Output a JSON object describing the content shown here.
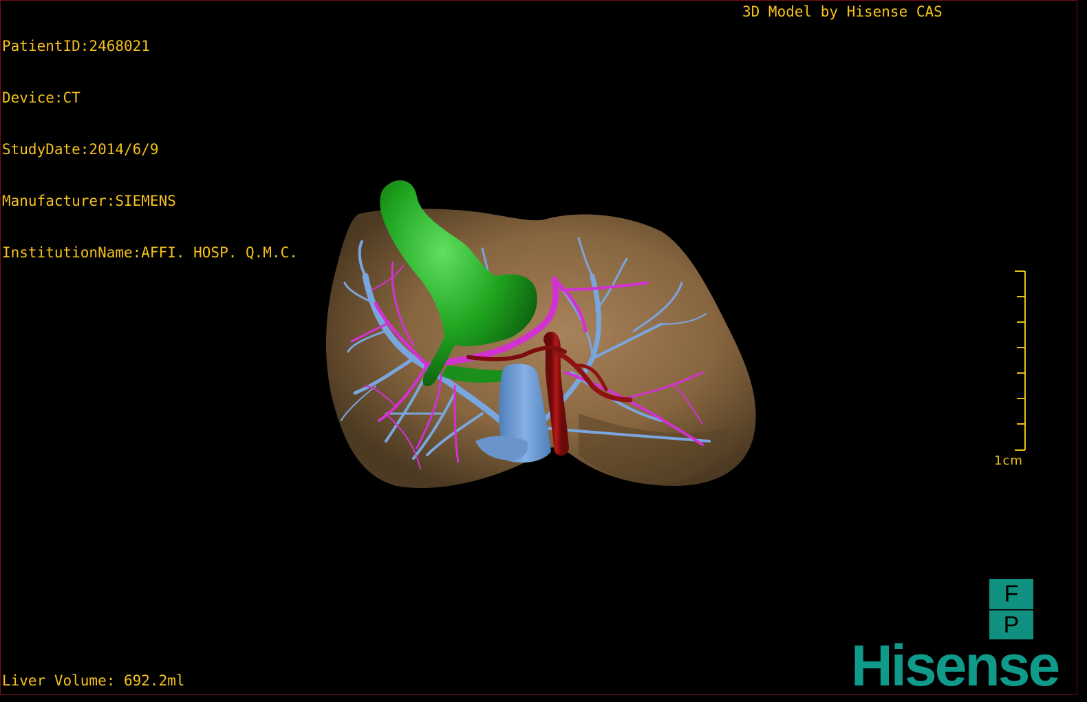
{
  "overlay": {
    "patient_id": "PatientID:2468021",
    "device": "Device:CT",
    "study_date": "StudyDate:2014/6/9",
    "manufacturer": "Manufacturer:SIEMENS",
    "institution": "InstitutionName:AFFI. HOSP. Q.M.C.",
    "credit": "3D Model by Hisense CAS",
    "liver_volume": "Liver Volume: 692.2ml"
  },
  "scale": {
    "label": "1cm"
  },
  "orientation": {
    "top": "F",
    "bottom": "P"
  },
  "brand": {
    "name": "Hisense"
  },
  "colors": {
    "overlay_text": "#f5c21b",
    "scale": "#e8c21a",
    "frame": "#7a0d1a",
    "brand": "#0f9a8a",
    "orientation_box": "#10907f",
    "liver": "#8a6a4a",
    "portal_vein": "#7aa6e0",
    "hepatic_vein": "#d431d4",
    "artery": "#9a1010",
    "gallbladder": "#1f9d1f"
  }
}
